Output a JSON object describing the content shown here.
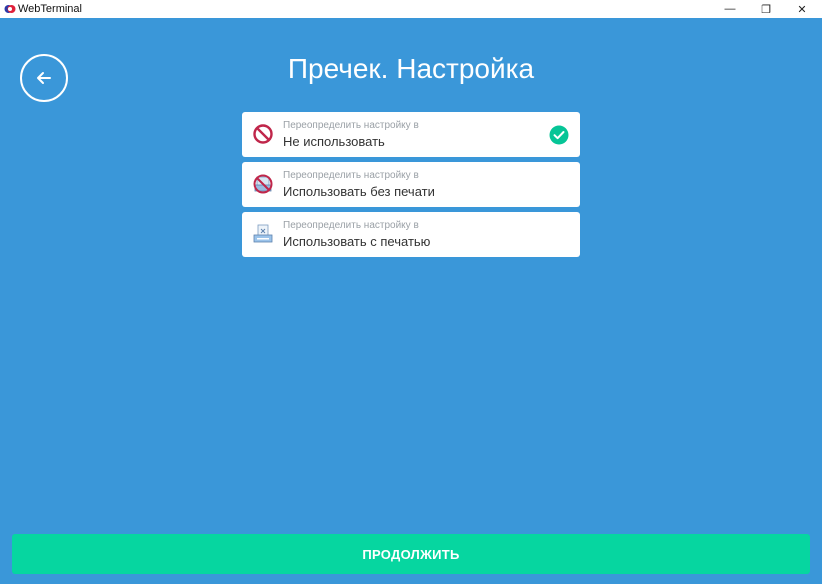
{
  "window": {
    "title": "WebTerminal",
    "controls": {
      "minimize": "—",
      "maximize": "❐",
      "close": "✕"
    }
  },
  "header": {
    "title": "Пречек. Настройка",
    "back_icon": "arrow-left-icon"
  },
  "options": [
    {
      "caption": "Переопределить настройку в",
      "label": "Не использовать",
      "icon": "no-entry-icon",
      "selected": true
    },
    {
      "caption": "Переопределить настройку в",
      "label": "Использовать без печати",
      "icon": "no-print-icon",
      "selected": false
    },
    {
      "caption": "Переопределить настройку в",
      "label": "Использовать с печатью",
      "icon": "printer-receipt-icon",
      "selected": false
    }
  ],
  "footer": {
    "continue_label": "ПРОДОЛЖИТЬ"
  },
  "colors": {
    "background": "#3a97d9",
    "accent": "#06d6a0",
    "icon_red": "#c0264a",
    "check_green": "#06c597"
  }
}
